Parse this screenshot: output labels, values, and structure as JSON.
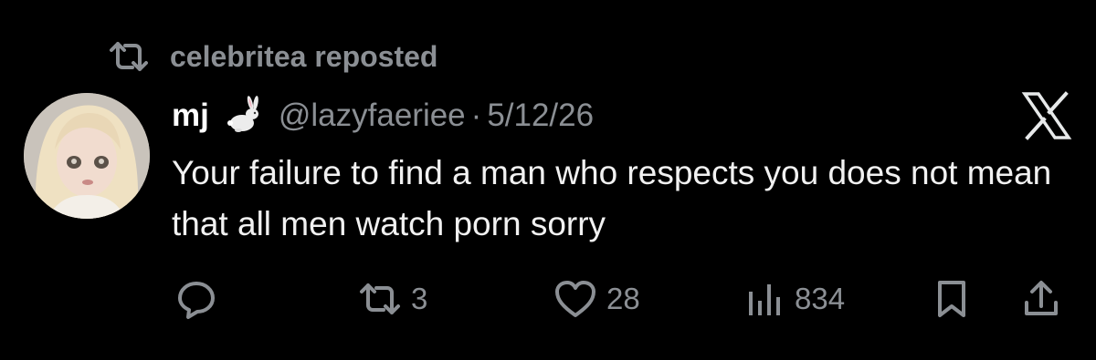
{
  "repost_banner": {
    "icon": "repost-icon",
    "text": "celebritea reposted"
  },
  "tweet": {
    "avatar": "avatar-image",
    "display_name": "mj",
    "name_emoji": "rabbit-icon",
    "handle": "@lazyfaeriee",
    "separator": "·",
    "date": "5/12/26",
    "text": "Your failure to find a man who respects you does not mean that all men watch porn sorry",
    "platform_logo": "x-logo-icon"
  },
  "actions": {
    "reply": {
      "icon": "reply-icon"
    },
    "repost": {
      "icon": "repost-icon",
      "count": "3"
    },
    "like": {
      "icon": "heart-icon",
      "count": "28"
    },
    "views": {
      "icon": "views-icon",
      "count": "834"
    },
    "bookmark": {
      "icon": "bookmark-icon"
    },
    "share": {
      "icon": "share-icon"
    }
  },
  "colors": {
    "background": "#000000",
    "primary_text": "#e7e9ea",
    "secondary_text": "#8b8f94"
  }
}
